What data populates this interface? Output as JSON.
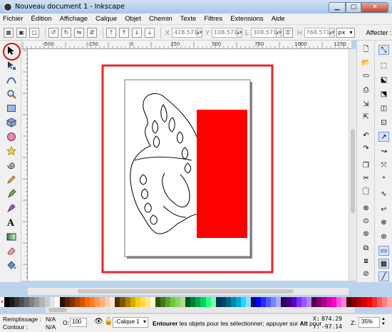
{
  "window": {
    "title": "Nouveau document 1 - Inkscape",
    "min_glyph": "▁",
    "max_glyph": "▢",
    "close_glyph": "✕"
  },
  "menu": [
    {
      "id": "fichier",
      "label": "Fichier"
    },
    {
      "id": "edition",
      "label": "Édition"
    },
    {
      "id": "affichage",
      "label": "Affichage"
    },
    {
      "id": "calque",
      "label": "Calque"
    },
    {
      "id": "objet",
      "label": "Objet"
    },
    {
      "id": "chemin",
      "label": "Chemin"
    },
    {
      "id": "texte",
      "label": "Texte"
    },
    {
      "id": "filtres",
      "label": "Filtres"
    },
    {
      "id": "extensions",
      "label": "Extensions"
    },
    {
      "id": "aide",
      "label": "Aide"
    }
  ],
  "controls": {
    "x_label": "X",
    "x_value": "428.571",
    "y_label": "Y",
    "y_value": "108.571",
    "w_label": "L",
    "w_value": "308.571",
    "h_label": "H",
    "h_value": "768.571",
    "unit": "px",
    "affecter": "Affecter :"
  },
  "ruler": {
    "labels": [
      "-500",
      "-250",
      "0",
      "250",
      "500",
      "750",
      "1000",
      "1250"
    ]
  },
  "palette": {
    "colors": [
      "#000000",
      "#1a1a1a",
      "#333333",
      "#4d4d4d",
      "#666666",
      "#808080",
      "#999999",
      "#b3b3b3",
      "#cccccc",
      "#e6e6e6",
      "#ffffff",
      "#2b1100",
      "#552200",
      "#803300",
      "#aa4400",
      "#d45500",
      "#ff6600",
      "#ff7f2a",
      "#ff9955",
      "#ffb380",
      "#ffccaa",
      "#ffe6d5",
      "#552b00",
      "#805500",
      "#aa7f00",
      "#d4aa00",
      "#ffcc00",
      "#ffdd55",
      "#ffe680",
      "#fff6d5",
      "#2b5500",
      "#447821",
      "#5aa02c",
      "#71c837",
      "#8dd35f",
      "#aade87",
      "#005522",
      "#008033",
      "#00aa44",
      "#00d455",
      "#2aff80",
      "#80ffb3",
      "#003355",
      "#004466",
      "#006680",
      "#0088aa",
      "#00aad4",
      "#2ad4ff",
      "#80e5ff",
      "#000080",
      "#0000ff",
      "#2a2aff",
      "#5555ff",
      "#8080ff",
      "#aaaaff",
      "#2b0055",
      "#440080",
      "#5500d4",
      "#7f2aff",
      "#9955ff",
      "#b380ff",
      "#550044",
      "#800066",
      "#aa0088",
      "#d400aa",
      "#ff00cc",
      "#ff55dd",
      "#ff80e5",
      "#550000",
      "#800000",
      "#aa0000",
      "#d40000",
      "#ff0000",
      "#ff2a2a",
      "#ff5555",
      "#ff8080",
      "#ffaaaa"
    ]
  },
  "status": {
    "fill_label": "Remplissage :",
    "fill_value": "N/A",
    "stroke_label": "Contour :",
    "stroke_value": "N/A",
    "opacity_label": "O:",
    "opacity_value": "100",
    "layer": "-Calque 1",
    "message_bold1": "Entourer",
    "message_mid": " les objets pour les sélectionner; appuyer sur ",
    "message_bold2": "Alt",
    "message_end": " pour",
    "cursor_x_label": "X:",
    "cursor_x": "874.29",
    "cursor_y_label": "Y:",
    "cursor_y": "-97.14",
    "zoom_label": "Z:",
    "zoom_value": "35%"
  },
  "colors": {
    "page_border": "#e02a2a",
    "red_rect": "#ff0000"
  }
}
